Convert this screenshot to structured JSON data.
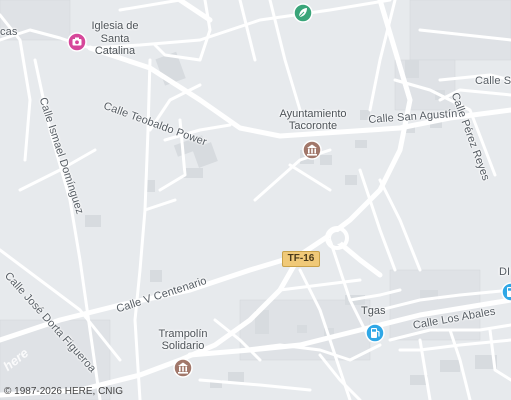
{
  "map": {
    "street_labels": {
      "calle_teobaldo_power": "Calle Teobaldo Power",
      "calle_san_agustin": "Calle San Agustín",
      "calle_ismael_dominguez": "Calle Ismael Domínguez",
      "calle_perez_reyes": "Calle Pérez Reyes",
      "calle_jose_dorta": "Calle José Dorta Figueroa",
      "calle_v_centenario": "Calle V Centenario",
      "calle_los_abales": "Calle Los Abales",
      "calle_sa": "Calle Sa",
      "cas": "cas",
      "di": "DI"
    },
    "pois": {
      "iglesia_line1": "Iglesia de",
      "iglesia_line2": "Santa",
      "iglesia_line3": "Catalina",
      "ayuntamiento_line1": "Ayuntamiento",
      "ayuntamiento_line2": "Tacoronte",
      "trampolin_line1": "Trampolín",
      "trampolin_line2": "Solidario",
      "tgas": "Tgas"
    },
    "road_shield": "TF-16",
    "copyright": "© 1987-2026 HERE, CNIG",
    "logo": "here",
    "icons": {
      "church": "camera-pin-icon",
      "city_hall": "building-pin-icon",
      "trampolin": "building-pin-icon",
      "gas": "fuel-pin-icon",
      "park": "leaf-pin-icon"
    },
    "colors": {
      "background": "#e7eaed",
      "road": "#ffffff",
      "poi_pink": "#d6479a",
      "poi_brown": "#a1776a",
      "poi_blue": "#2fa7e6",
      "poi_green": "#3aa57a",
      "highway": "#f0c978"
    }
  }
}
